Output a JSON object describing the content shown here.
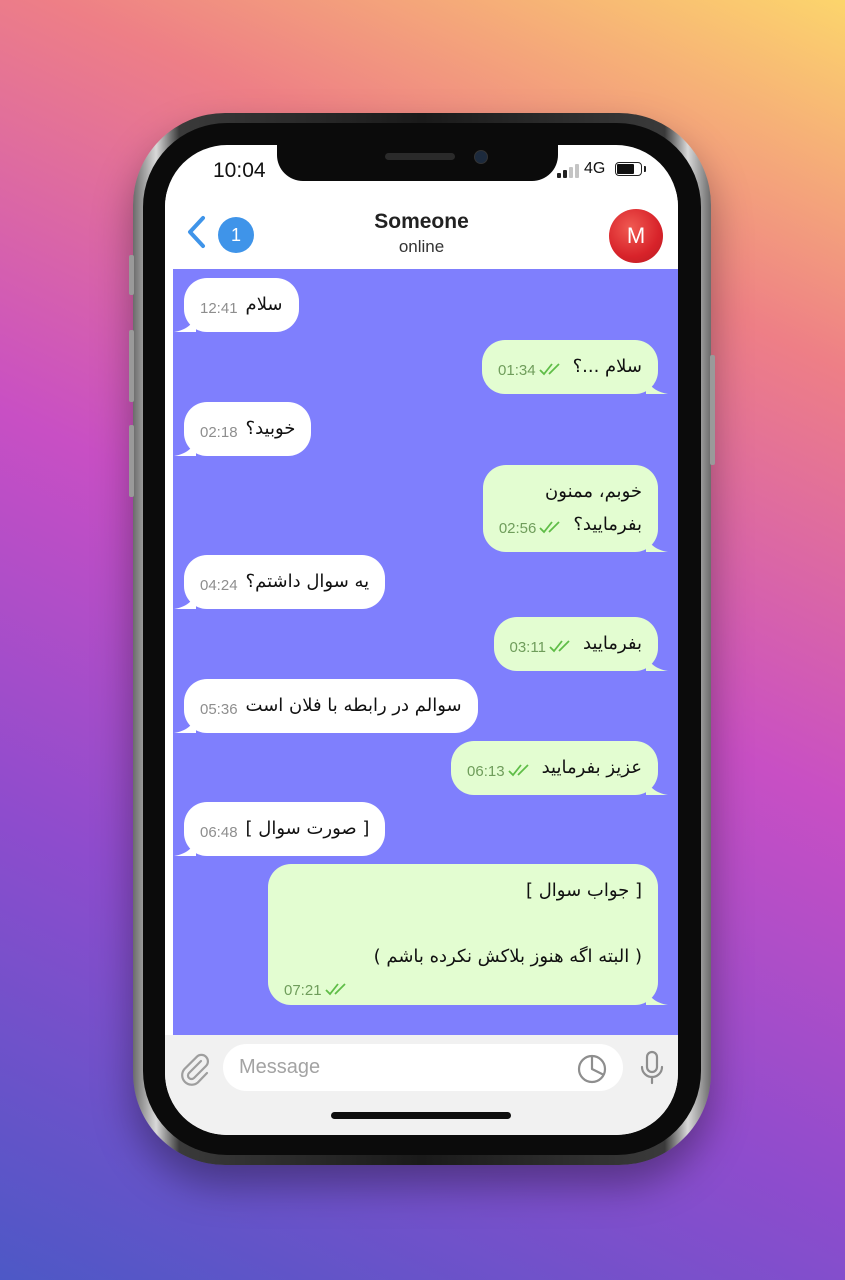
{
  "status_bar": {
    "time": "10:04",
    "network": "4G",
    "battery_level": 0.75,
    "signal_bars_active": 2
  },
  "header": {
    "back_label": "back",
    "unread_count": "1",
    "title": "Someone",
    "status": "online",
    "avatar_letter": "M"
  },
  "messages": [
    {
      "text": "سلام",
      "time": "12:41",
      "outgoing": false
    },
    {
      "text": "سلام ...؟",
      "time": "01:34",
      "outgoing": true
    },
    {
      "text": "خوبید؟",
      "time": "02:18",
      "outgoing": false
    },
    {
      "text": "خوبم، ممنون\nبفرمایید؟",
      "time": "02:56",
      "outgoing": true
    },
    {
      "text": "یه سوال داشتم؟",
      "time": "04:24",
      "outgoing": false
    },
    {
      "text": "بفرمایید",
      "time": "03:11",
      "outgoing": true
    },
    {
      "text": "سوالم در رابطه با فلان است",
      "time": "05:36",
      "outgoing": false
    },
    {
      "text": "عزیز بفرمایید",
      "time": "06:13",
      "outgoing": true
    },
    {
      "text": "[ صورت سوال ]",
      "time": "06:48",
      "outgoing": false
    },
    {
      "text": "[ جواب سوال ]\n\n( البته اگه هنوز بلاکش نکرده باشم )",
      "time": "07:21",
      "outgoing": true
    }
  ],
  "composer": {
    "placeholder": "Message"
  },
  "colors": {
    "chat_background": "#7f7ffd",
    "incoming_bubble": "#ffffff",
    "outgoing_bubble": "#e3fdd1",
    "accent": "#3f94e9",
    "read_check": "#5fbd47"
  }
}
